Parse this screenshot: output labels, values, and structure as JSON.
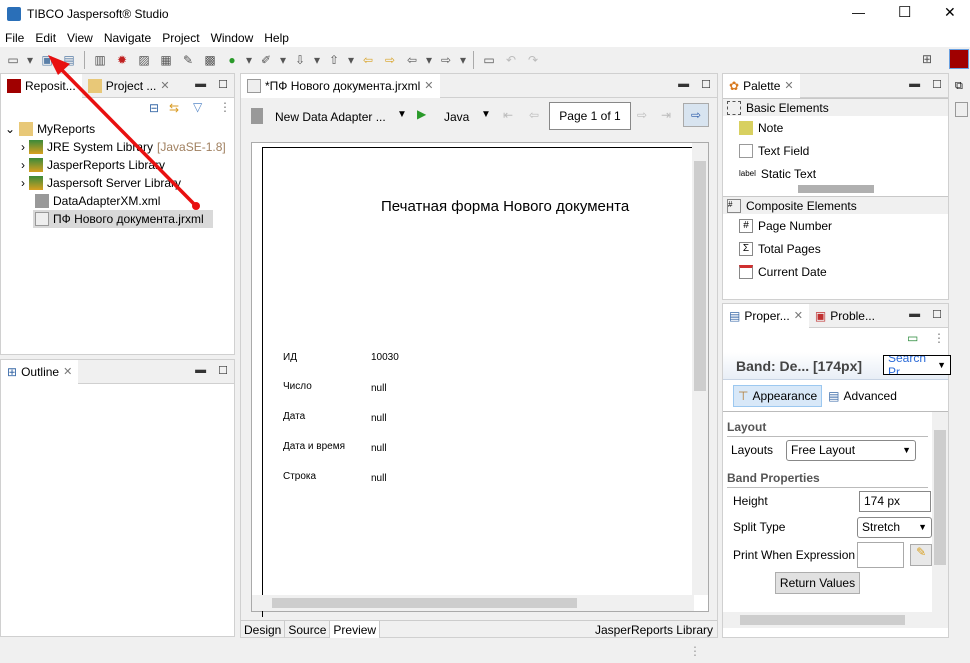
{
  "window": {
    "title": "TIBCO Jaspersoft® Studio",
    "minimize": "—",
    "maximize": "☐",
    "close": "✕"
  },
  "menu": [
    "File",
    "Edit",
    "View",
    "Navigate",
    "Project",
    "Window",
    "Help"
  ],
  "left_panel": {
    "tabs": [
      {
        "label": "Reposit..."
      },
      {
        "label": "Project ..."
      }
    ],
    "tree": {
      "root": "MyReports",
      "items": [
        {
          "label": "JRE System Library",
          "suffix": "[JavaSE-1.8]"
        },
        {
          "label": "JasperReports Library",
          "suffix": ""
        },
        {
          "label": "Jaspersoft Server Library",
          "suffix": ""
        },
        {
          "label": "DataAdapterXM.xml",
          "suffix": ""
        },
        {
          "label": "ПФ Нового документа.jrxml",
          "suffix": ""
        }
      ]
    }
  },
  "outline": {
    "tab": "Outline"
  },
  "editor": {
    "tab": "*ПФ Нового документа.jrxml",
    "data_adapter": "New Data Adapter ...",
    "language": "Java",
    "page": "Page 1 of 1",
    "report": {
      "title": "Печатная форма Нового документа",
      "fields": [
        {
          "label": "ИД",
          "value": "10030"
        },
        {
          "label": "Число",
          "value": "null"
        },
        {
          "label": "Дата",
          "value": "null"
        },
        {
          "label": "Дата и время",
          "value": "null"
        },
        {
          "label": "Строка",
          "value": "null"
        }
      ]
    },
    "bottom_tabs": [
      "Design",
      "Source",
      "Preview"
    ],
    "active_bottom_tab": "Preview",
    "library": "JasperReports Library"
  },
  "palette": {
    "tab": "Palette",
    "sections": [
      {
        "title": "Basic Elements",
        "items": [
          "Note",
          "Text Field",
          "Static Text"
        ]
      },
      {
        "title": "Composite Elements",
        "items": [
          "Page Number",
          "Total Pages",
          "Current Date"
        ]
      }
    ]
  },
  "properties": {
    "tabs": [
      "Proper...",
      "Proble..."
    ],
    "heading": "Band: De... [174px]",
    "search_placeholder": "Search Pr",
    "subtabs": [
      "Appearance",
      "Advanced"
    ],
    "layout_section": "Layout",
    "layouts_label": "Layouts",
    "layouts_value": "Free Layout",
    "band_section": "Band Properties",
    "height_label": "Height",
    "height_value": "174 px",
    "split_label": "Split Type",
    "split_value": "Stretch",
    "print_label": "Print When Expression",
    "return_values": "Return Values"
  },
  "colors": {
    "accent_arrow": "#e81010",
    "selection": "#d9d9d9",
    "jaspersoft_red": "#a00000"
  }
}
